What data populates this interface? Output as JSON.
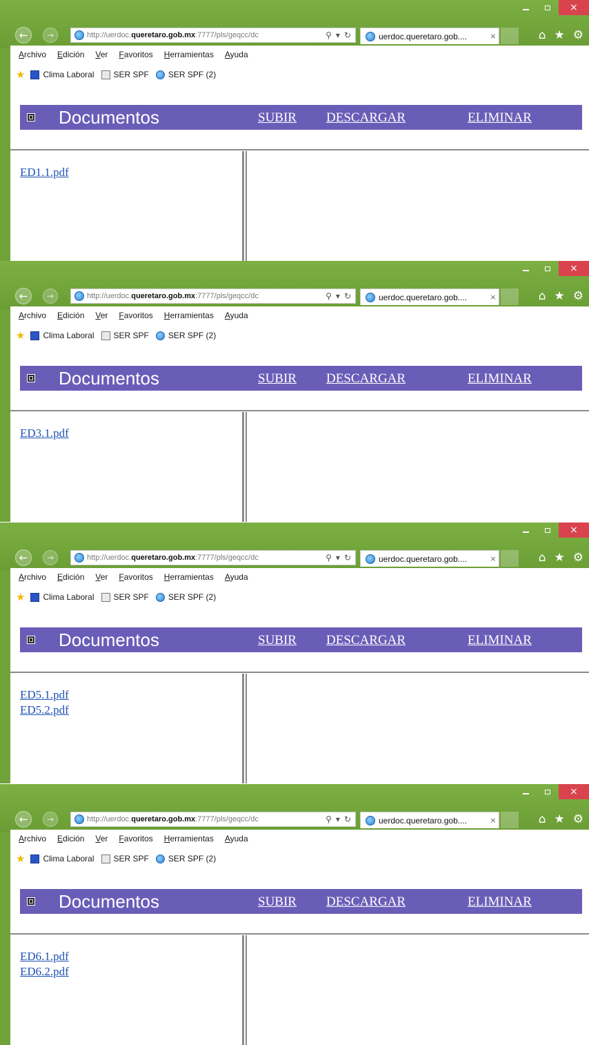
{
  "window": {
    "url_prefix": "http://uerdoc.",
    "url_domain": "queretaro.gob.mx",
    "url_suffix": ":7777/pls/geqcc/dc",
    "tab_title": "uerdoc.queretaro.gob....",
    "tab_close": "×",
    "caption_close": "×"
  },
  "menu": [
    "Archivo",
    "Edición",
    "Ver",
    "Favoritos",
    "Herramientas",
    "Ayuda"
  ],
  "favorites": [
    "Clima Laboral",
    "SER SPF",
    "SER SPF (2)"
  ],
  "page": {
    "title": "Documentos",
    "upload": "SUBIR",
    "download": "DESCARGAR",
    "delete": "ELIMINAR"
  },
  "screens": [
    {
      "files": [
        "ED1.1.pdf"
      ]
    },
    {
      "files": [
        "ED3.1.pdf"
      ]
    },
    {
      "files": [
        "ED5.1.pdf",
        "ED5.2.pdf"
      ]
    },
    {
      "files": [
        "ED6.1.pdf",
        "ED6.2.pdf"
      ]
    }
  ]
}
